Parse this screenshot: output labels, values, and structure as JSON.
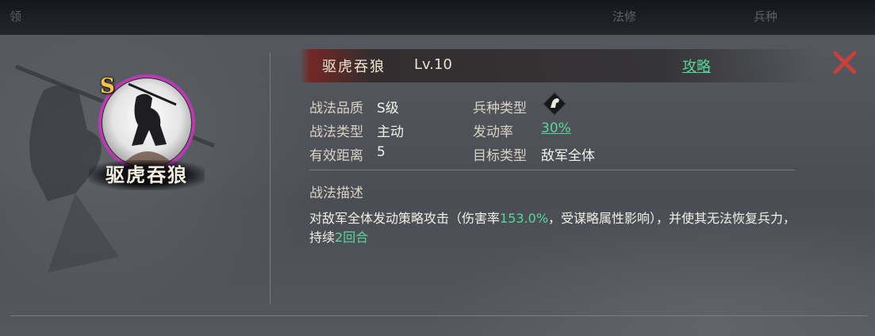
{
  "skill": {
    "portrait_name": "驱虎吞狼",
    "grade_badge": "S",
    "title": "驱虎吞狼",
    "level": "Lv.10",
    "guide_link": "攻略",
    "attributes": {
      "quality_label": "战法品质",
      "quality_value": "S级",
      "troop_type_label": "兵种类型",
      "troop_type_icon": "horse-head-icon",
      "skill_type_label": "战法类型",
      "skill_type_value": "主动",
      "trigger_rate_label": "发动率",
      "trigger_rate_value": "30%",
      "range_label": "有效距离",
      "range_value": "5",
      "target_type_label": "目标类型",
      "target_type_value": "敌军全体"
    },
    "description": {
      "title": "战法描述",
      "part1": "对敌军全体发动策略攻击（伤害率",
      "damage_rate": "153.0%",
      "part2": "，受谋略属性影响），并使其无法恢复兵力，持续",
      "duration": "2回合",
      "part3": ""
    }
  },
  "colors": {
    "accent_green": "#58d69a",
    "close_red": "#c8403a",
    "grade_gold": "#f3c34a",
    "portrait_ring": "#b63cb0"
  },
  "background_topbar": {
    "ghost_left": "领",
    "ghost_mid": "法修",
    "ghost_right": "兵种"
  }
}
